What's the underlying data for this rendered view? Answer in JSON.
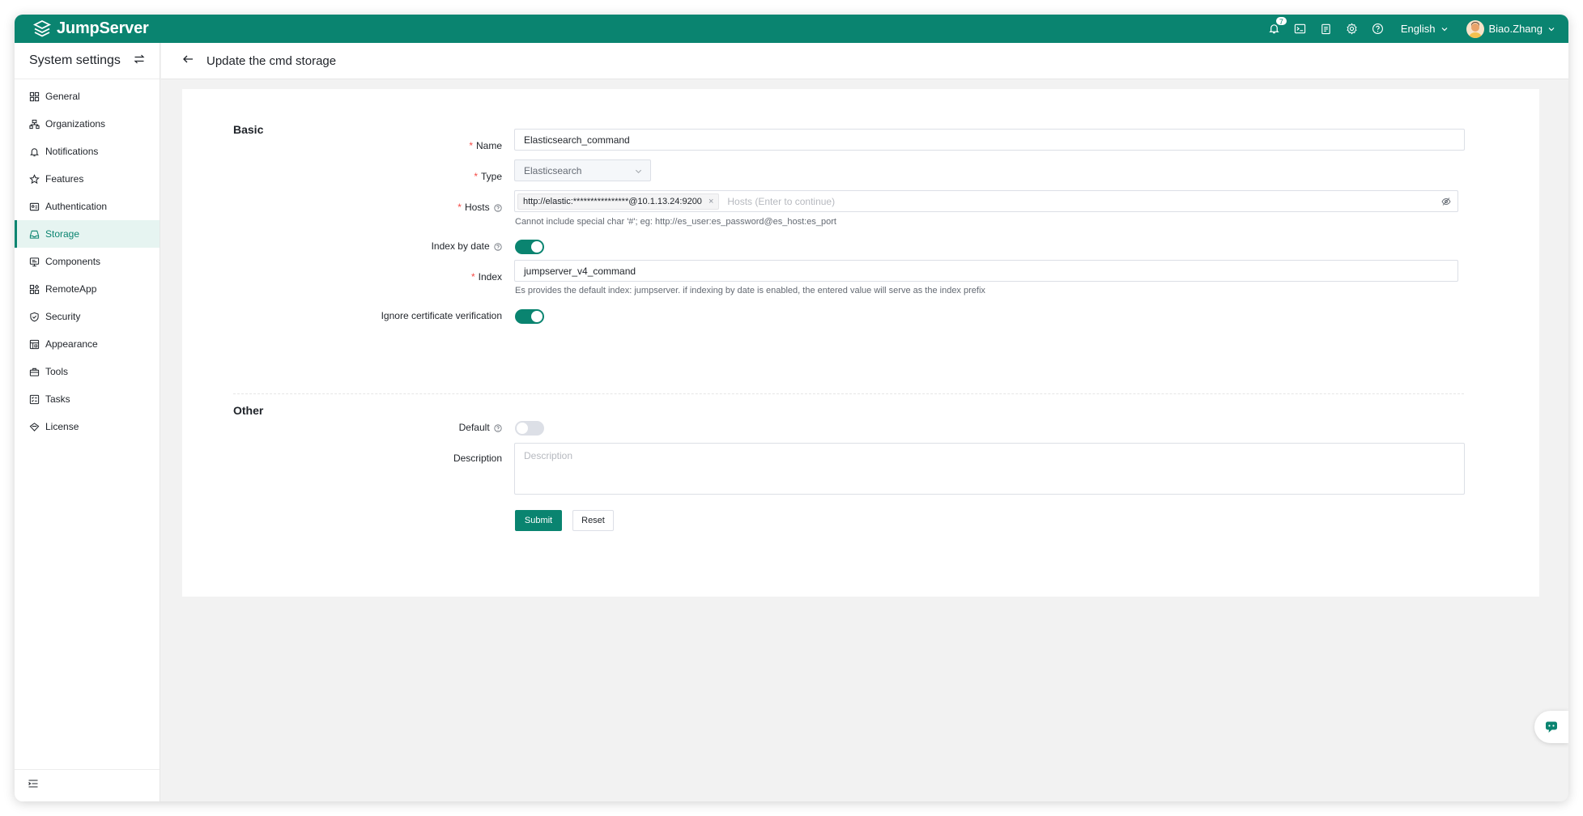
{
  "app": {
    "brand": "JumpServer"
  },
  "topbar": {
    "notification_count": "7",
    "language": "English",
    "user_name": "Biao.Zhang"
  },
  "sidebar": {
    "title": "System settings",
    "items": [
      {
        "label": "General",
        "icon": "grid-icon"
      },
      {
        "label": "Organizations",
        "icon": "org-icon"
      },
      {
        "label": "Notifications",
        "icon": "bell-icon"
      },
      {
        "label": "Features",
        "icon": "star-icon"
      },
      {
        "label": "Authentication",
        "icon": "id-card-icon"
      },
      {
        "label": "Storage",
        "icon": "storage-icon",
        "active": true
      },
      {
        "label": "Components",
        "icon": "monitor-icon"
      },
      {
        "label": "RemoteApp",
        "icon": "apps-icon"
      },
      {
        "label": "Security",
        "icon": "shield-icon"
      },
      {
        "label": "Appearance",
        "icon": "palette-icon"
      },
      {
        "label": "Tools",
        "icon": "toolbox-icon"
      },
      {
        "label": "Tasks",
        "icon": "tasks-icon"
      },
      {
        "label": "License",
        "icon": "license-icon"
      }
    ]
  },
  "page": {
    "title": "Update the cmd storage"
  },
  "form": {
    "basic_title": "Basic",
    "other_title": "Other",
    "name_label": "Name",
    "name_value": "Elasticsearch_command",
    "type_label": "Type",
    "type_value": "Elasticsearch",
    "hosts_label": "Hosts",
    "hosts_tag": "http://elastic:****************@10.1.13.24:9200",
    "hosts_tag_close": "×",
    "hosts_placeholder": "Hosts (Enter to continue)",
    "hosts_hint": "Cannot include special char '#'; eg: http://es_user:es_password@es_host:es_port",
    "index_by_date_label": "Index by date",
    "index_by_date": true,
    "index_label": "Index",
    "index_value": "jumpserver_v4_command",
    "index_hint": "Es provides the default index: jumpserver. if indexing by date is enabled, the entered value will serve as the index prefix",
    "ignore_cert_label": "Ignore certificate verification",
    "ignore_cert": true,
    "default_label": "Default",
    "default_value": false,
    "description_label": "Description",
    "description_placeholder": "Description",
    "submit_label": "Submit",
    "reset_label": "Reset"
  },
  "colors": {
    "brand": "#0a8470",
    "required": "#f54a45"
  }
}
